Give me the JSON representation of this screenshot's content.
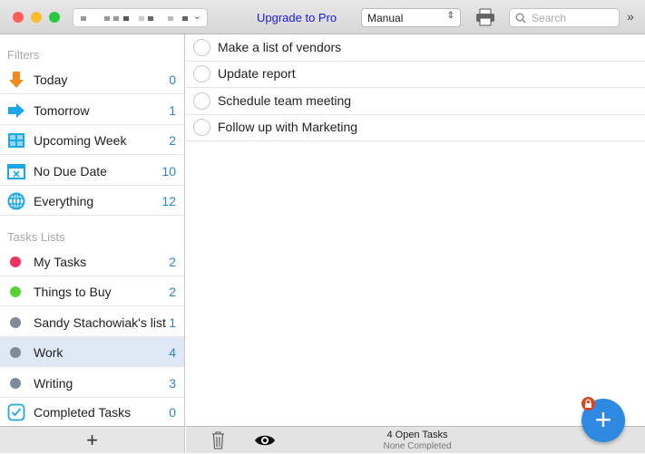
{
  "toolbar": {
    "upgrade": "Upgrade to Pro",
    "sort": "Manual",
    "search_placeholder": "Search",
    "more": "»"
  },
  "filters": {
    "header": "Filters",
    "items": [
      {
        "label": "Today",
        "count": "0",
        "icon": "arrow-down-icon",
        "color": "#f28a1c"
      },
      {
        "label": "Tomorrow",
        "count": "1",
        "icon": "arrow-right-icon",
        "color": "#1ca8e8"
      },
      {
        "label": "Upcoming Week",
        "count": "2",
        "icon": "calendar-grid-icon",
        "color": "#1ca8e8"
      },
      {
        "label": "No Due Date",
        "count": "10",
        "icon": "calendar-x-icon",
        "color": "#1ca8e8"
      },
      {
        "label": "Everything",
        "count": "12",
        "icon": "globe-icon",
        "color": "#1ca8e8"
      }
    ]
  },
  "lists": {
    "header": "Tasks Lists",
    "items": [
      {
        "label": "My Tasks",
        "count": "2",
        "color": "#f0325e"
      },
      {
        "label": "Things to Buy",
        "count": "2",
        "color": "#58d236"
      },
      {
        "label": "Sandy Stachowiak's list",
        "count": "1",
        "color": "#7f8b9b"
      },
      {
        "label": "Work",
        "count": "4",
        "color": "#7f8b9b",
        "selected": true
      },
      {
        "label": "Writing",
        "count": "3",
        "color": "#7f8b9b"
      }
    ],
    "completed": {
      "label": "Completed Tasks",
      "count": "0"
    }
  },
  "sidebar_footer": {
    "add": "+"
  },
  "tasks": [
    "Make a list of vendors",
    "Update report",
    "Schedule team meeting",
    "Follow up with Marketing"
  ],
  "status": {
    "open": "4 Open Tasks",
    "completed": "None Completed"
  },
  "fab": "+"
}
